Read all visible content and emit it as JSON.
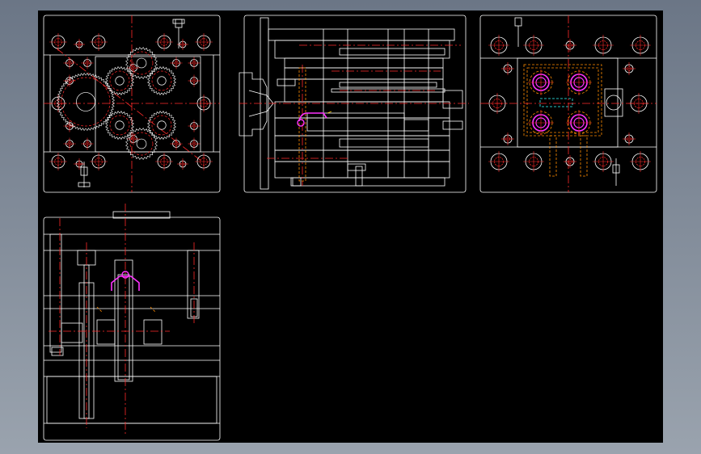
{
  "colors": {
    "backdrop_top": "#6b7686",
    "backdrop_bottom": "#9aa3ae",
    "sheet": "#000000",
    "outline": "#ffffff",
    "centerline": "#ff2a2a",
    "hidden": "#ff8c00",
    "part": "#ff33ff",
    "aux": "#33ffff",
    "yellow": "#ffd200"
  },
  "views": [
    {
      "id": "top-view",
      "kind": "plan",
      "gears": 6
    },
    {
      "id": "front-section",
      "kind": "section"
    },
    {
      "id": "side-view",
      "kind": "plan",
      "cavities": 4
    },
    {
      "id": "side-section",
      "kind": "section"
    }
  ]
}
